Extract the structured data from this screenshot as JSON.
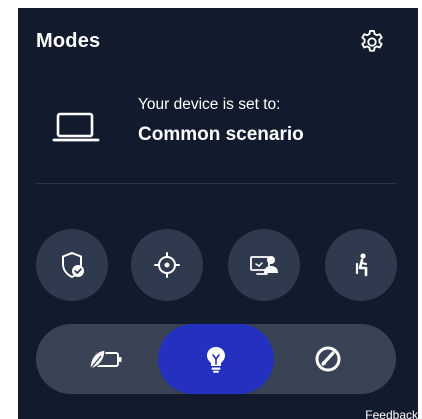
{
  "header": {
    "title": "Modes"
  },
  "status": {
    "line1": "Your device is set to:",
    "line2": "Common scenario"
  },
  "quick_actions": [
    {
      "icon": "shield-check-icon"
    },
    {
      "icon": "crosshair-icon"
    },
    {
      "icon": "presentation-person-icon"
    },
    {
      "icon": "seated-person-icon"
    }
  ],
  "modes": [
    {
      "icon": "battery-leaf-icon",
      "selected": false
    },
    {
      "icon": "lightbulb-icon",
      "selected": true
    },
    {
      "icon": "speedometer-icon",
      "selected": false
    }
  ],
  "footer": {
    "feedback_label": "Feedback"
  },
  "colors": {
    "panel_bg": "#121a2d",
    "button_bg": "#303a4e",
    "track_bg": "#3a4256",
    "accent": "#2431c0",
    "text": "#ffffff"
  }
}
